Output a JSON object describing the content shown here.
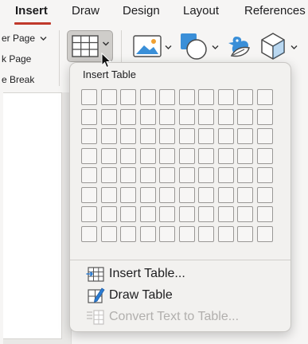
{
  "tabs": [
    {
      "label": "Insert",
      "active": true
    },
    {
      "label": "Draw",
      "active": false
    },
    {
      "label": "Design",
      "active": false
    },
    {
      "label": "Layout",
      "active": false
    },
    {
      "label": "References",
      "active": false
    }
  ],
  "page_group": {
    "items": [
      {
        "label": "er Page",
        "has_dropdown": true
      },
      {
        "label": "k Page",
        "has_dropdown": false
      },
      {
        "label": "e Break",
        "has_dropdown": false
      }
    ]
  },
  "ribbon_icons": [
    "table-icon",
    "picture-icon",
    "shapes-icon",
    "icons-icon",
    "3d-models-icon"
  ],
  "insert_table_menu": {
    "title": "Insert Table",
    "grid": {
      "columns": 10,
      "rows": 8
    },
    "items": [
      {
        "label": "Insert Table...",
        "icon": "insert-table-icon",
        "enabled": true
      },
      {
        "label": "Draw Table",
        "icon": "draw-table-icon",
        "enabled": true
      },
      {
        "label": "Convert Text to Table...",
        "icon": "convert-text-to-table-icon",
        "enabled": false
      }
    ]
  },
  "colors": {
    "active_tab_underline": "#c0392b",
    "grid_cell_border": "#9a9896",
    "disabled_text": "#b1afad"
  }
}
